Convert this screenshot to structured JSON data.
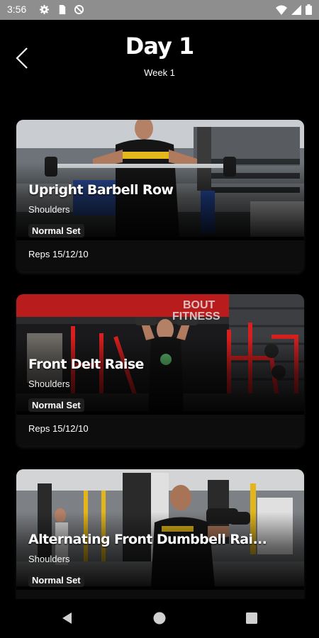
{
  "status_bar": {
    "time": "3:56",
    "left_icons": [
      "gear-icon",
      "sim-card-icon",
      "no-data-icon"
    ],
    "right_icons": [
      "wifi-icon",
      "signal-icon",
      "battery-icon"
    ]
  },
  "header": {
    "title": "Day 1",
    "subtitle": "Week 1",
    "back_icon": "chevron-left-icon"
  },
  "exercises": [
    {
      "name": "Upright Barbell Row",
      "category": "Shoulders",
      "set_type": "Normal Set",
      "reps": "Reps 15/12/10"
    },
    {
      "name": "Front Delt Raise",
      "category": "Shoulders",
      "set_type": "Normal Set",
      "reps": "Reps 15/12/10"
    },
    {
      "name": "Alternating Front Dumbbell Rai...",
      "category": "Shoulders",
      "set_type": "Normal Set",
      "reps": ""
    }
  ],
  "nav_bar": {
    "icons": [
      "back-triangle-icon",
      "home-circle-icon",
      "recents-square-icon"
    ]
  },
  "colors": {
    "background": "#000000",
    "status_bar": "#8e8e8e",
    "badge": "#1e1e1e",
    "gym_red": "#d61f1f"
  }
}
